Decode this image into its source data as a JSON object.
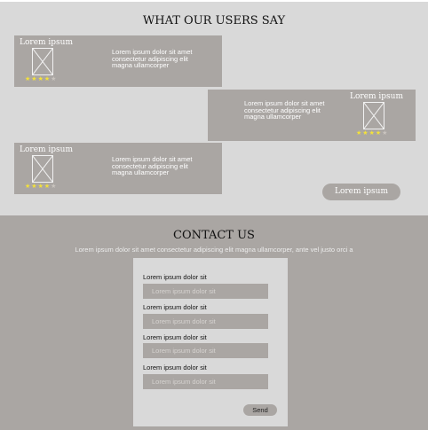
{
  "testimonials": {
    "title": "WHAT OUR USERS SAY",
    "cards": [
      {
        "name": "Lorem ipsum",
        "quote": "Lorem ipsum dolor sit amet consectetur adipiscing elit magna ullamcorper",
        "rating": 4,
        "rating_max": 5
      },
      {
        "name": "Lorem ipsum",
        "quote": "Lorem ipsum dolor sit amet consectetur adipiscing elit magna ullamcorper",
        "rating": 4,
        "rating_max": 5
      },
      {
        "name": "Lorem ipsum",
        "quote": "Lorem ipsum dolor sit amet consectetur adipiscing elit magna ullamcorper",
        "rating": 4,
        "rating_max": 5
      }
    ],
    "button_label": "Lorem ipsum",
    "star_color": "#f3e13a"
  },
  "contact": {
    "title": "CONTACT US",
    "subtitle": "Lorem ipsum dolor sit amet consectetur adipiscing elit magna ullamcorper, ante vel justo orci a",
    "fields": [
      {
        "label": "Lorem ipsum dolor sit",
        "placeholder": "Lorem ipsum dolor sit"
      },
      {
        "label": "Lorem ipsum dolor sit",
        "placeholder": "Lorem ipsum dolor sit"
      },
      {
        "label": "Lorem ipsum dolor sit",
        "placeholder": "Lorem ipsum dolor sit"
      },
      {
        "label": "Lorem ipsum dolor sit",
        "placeholder": "Lorem ipsum dolor sit"
      }
    ],
    "send_label": "Send"
  },
  "colors": {
    "section_light": "#d9d9d9",
    "section_dark": "#aaa6a3",
    "card": "#aaa6a3"
  }
}
